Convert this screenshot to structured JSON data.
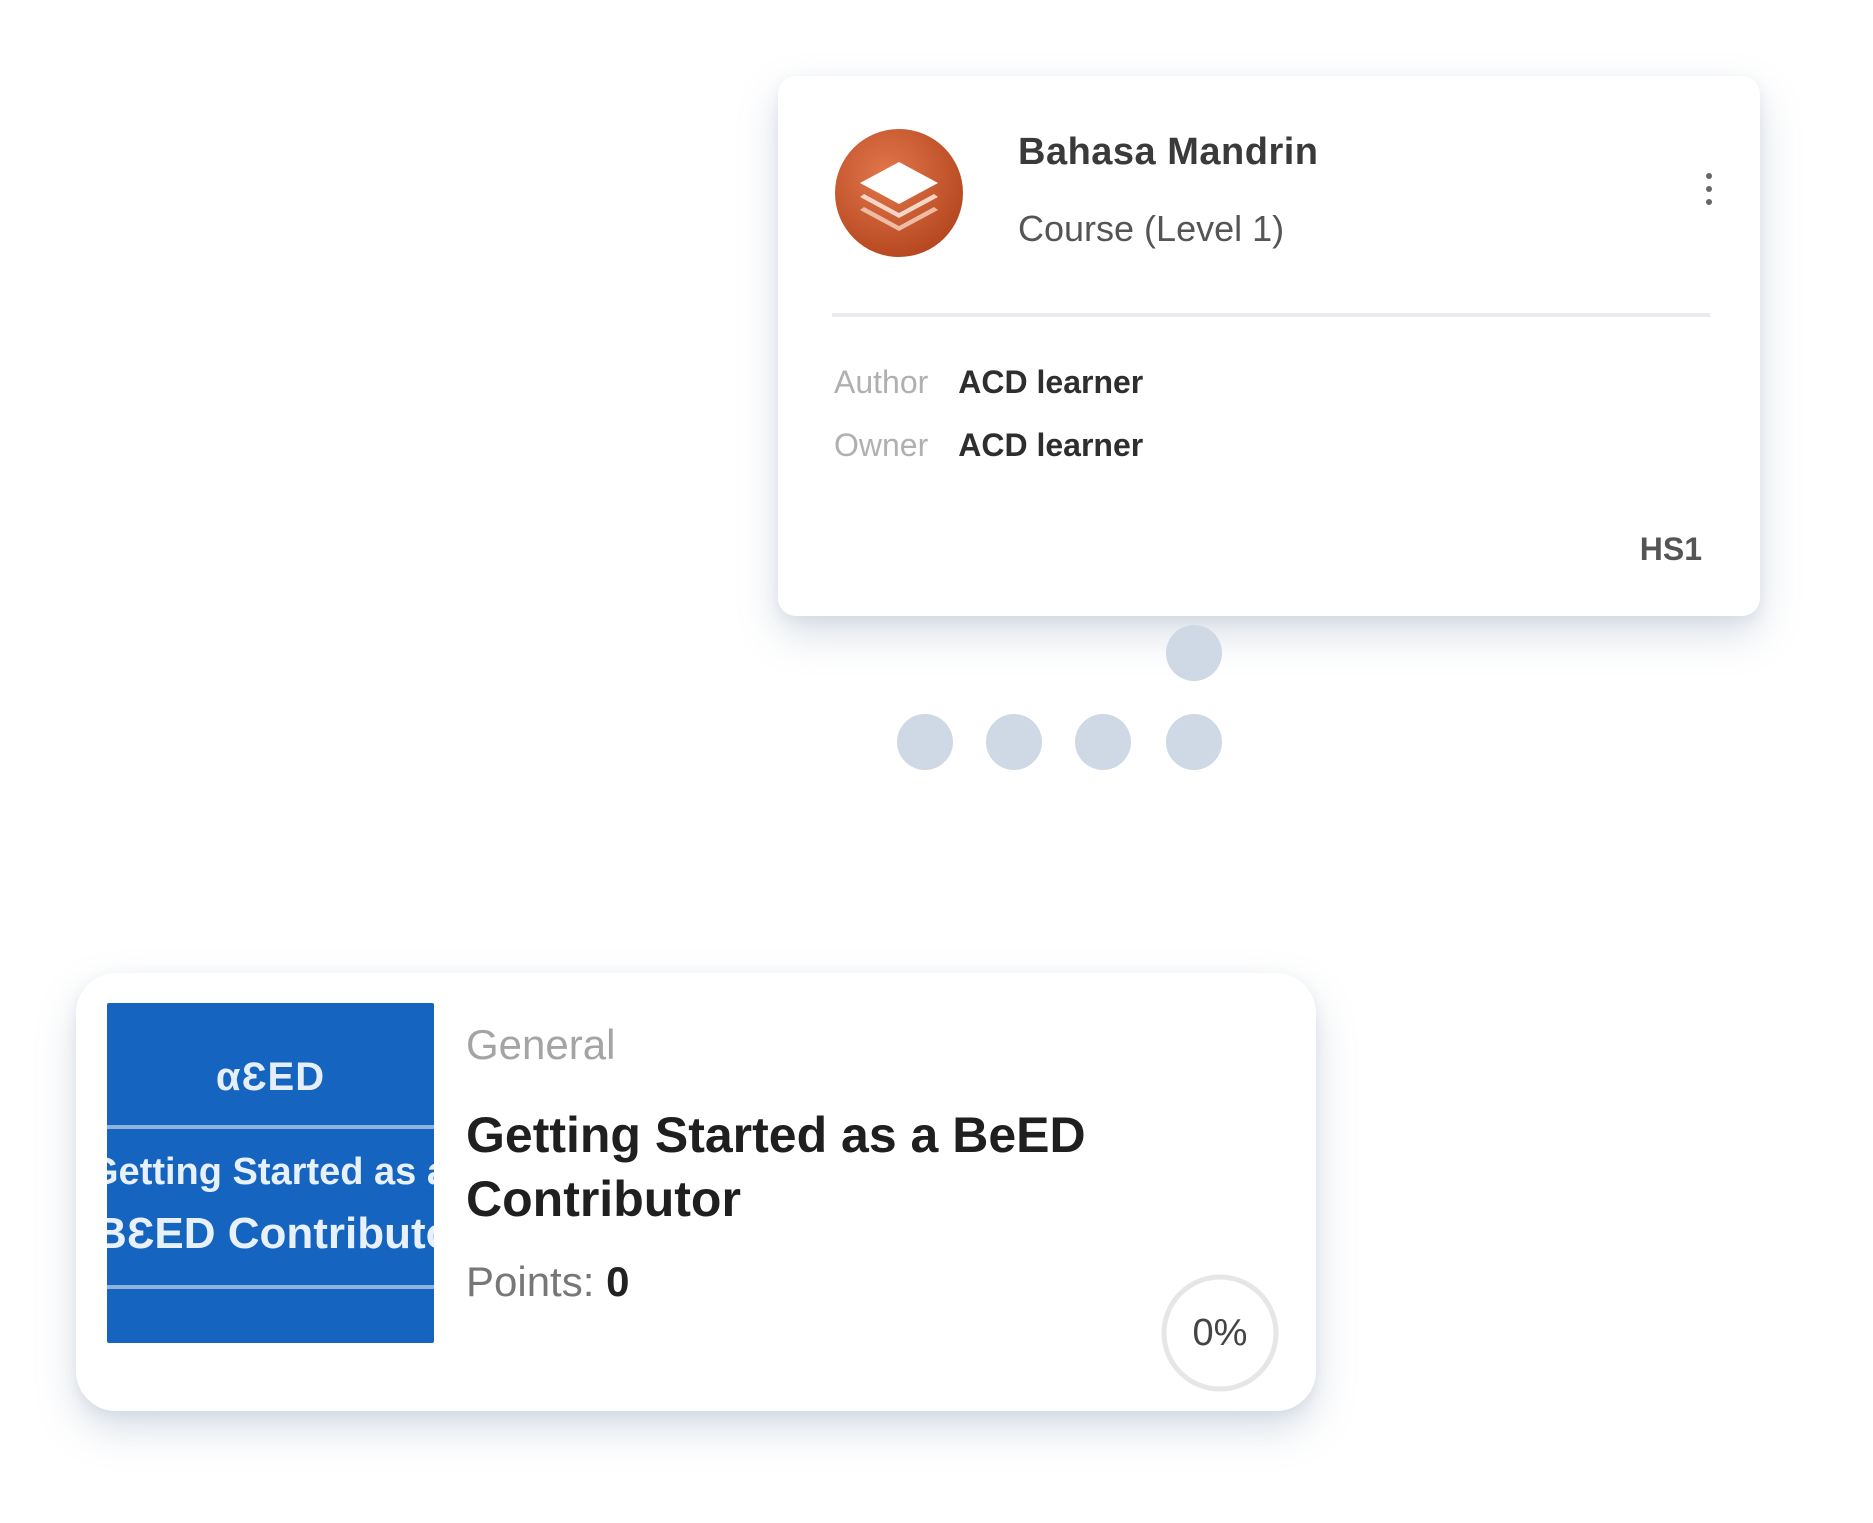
{
  "course_card": {
    "title": "Bahasa Mandrin",
    "subtitle": "Course (Level 1)",
    "icon": "layers-icon",
    "icon_color": "#c9572b",
    "menu_icon": "more-vertical-icon",
    "meta": {
      "author_label": "Author",
      "author_value": "ACD learner",
      "owner_label": "Owner",
      "owner_value": "ACD learner"
    },
    "code": "HS1"
  },
  "dots_color": "#cfd8e5",
  "module_card": {
    "thumbnail": {
      "logo": "αƐED",
      "line1": "Getting Started as a",
      "line2": "BƐED Contributor",
      "background": "#1565c0"
    },
    "category": "General",
    "title": "Getting Started as a BeED Contributor",
    "points_label": "Points:",
    "points_value": "0",
    "progress_percent": 0,
    "progress_label": "0%"
  }
}
